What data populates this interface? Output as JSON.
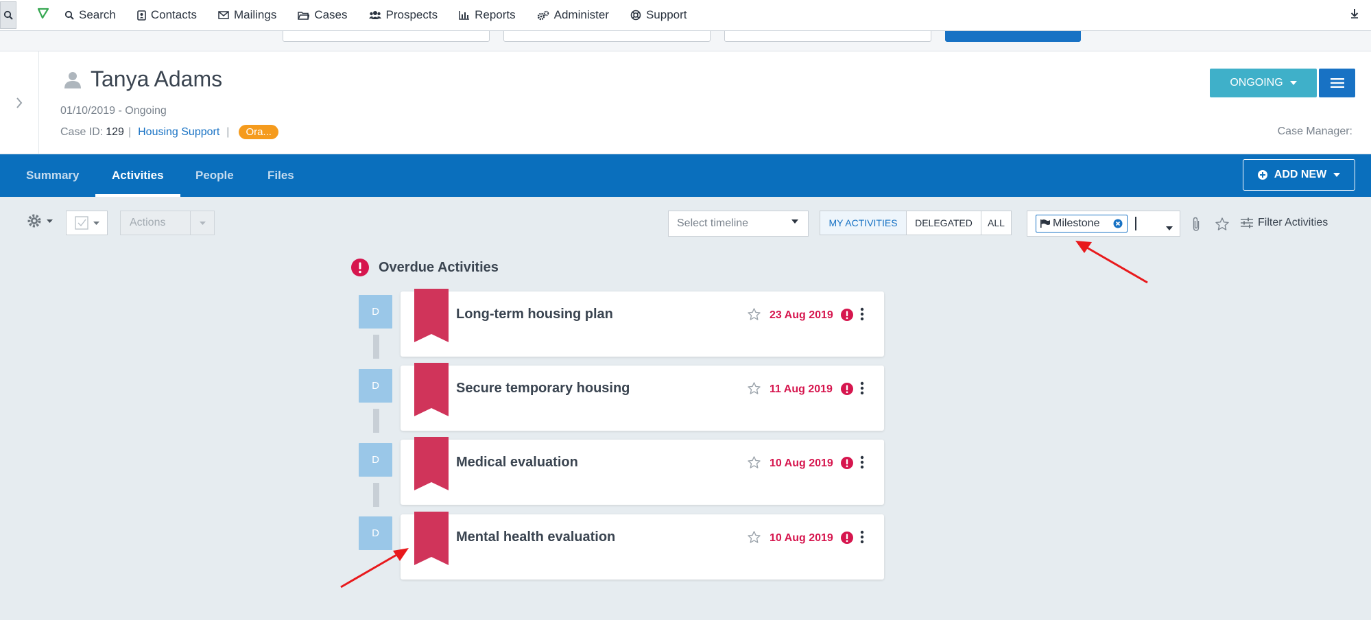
{
  "nav": {
    "items": [
      {
        "label": "Search",
        "icon": "search-icon"
      },
      {
        "label": "Contacts",
        "icon": "contacts-icon"
      },
      {
        "label": "Mailings",
        "icon": "mail-icon"
      },
      {
        "label": "Cases",
        "icon": "folder-icon"
      },
      {
        "label": "Prospects",
        "icon": "users-icon"
      },
      {
        "label": "Reports",
        "icon": "bar-chart-icon"
      },
      {
        "label": "Administer",
        "icon": "gears-icon"
      },
      {
        "label": "Support",
        "icon": "lifebuoy-icon"
      }
    ]
  },
  "case": {
    "name": "Tanya Adams",
    "date_status": "01/10/2019 - Ongoing",
    "case_id_label": "Case ID:",
    "case_id": "129",
    "case_type": "Housing Support",
    "tag": "Ora...",
    "status_button": "ONGOING",
    "case_manager_label": "Case Manager:"
  },
  "tabs": [
    {
      "label": "Summary",
      "active": false
    },
    {
      "label": "Activities",
      "active": true
    },
    {
      "label": "People",
      "active": false
    },
    {
      "label": "Files",
      "active": false
    }
  ],
  "add_new_label": "ADD NEW",
  "toolbar": {
    "actions_placeholder": "Actions",
    "timeline_placeholder": "Select timeline",
    "filters": [
      "MY ACTIVITIES",
      "DELEGATED",
      "ALL"
    ],
    "active_filter": "MY ACTIVITIES",
    "type_chip": "Milestone",
    "filter_activities_label": "Filter Activities"
  },
  "overdue_title": "Overdue Activities",
  "activities": [
    {
      "avatar": "D",
      "title": "Long-term housing plan",
      "date": "23 Aug 2019"
    },
    {
      "avatar": "D",
      "title": "Secure temporary housing",
      "date": "11 Aug 2019"
    },
    {
      "avatar": "D",
      "title": "Medical evaluation",
      "date": "10 Aug 2019"
    },
    {
      "avatar": "D",
      "title": "Mental health evaluation",
      "date": "10 Aug 2019"
    }
  ],
  "colors": {
    "brand_blue": "#0a6fbd",
    "teal": "#3fb0c9",
    "overdue_red": "#d6164e",
    "ribbon": "#d0345a",
    "tag_orange": "#f59b1d",
    "annotation_arrow": "#e8191c"
  }
}
